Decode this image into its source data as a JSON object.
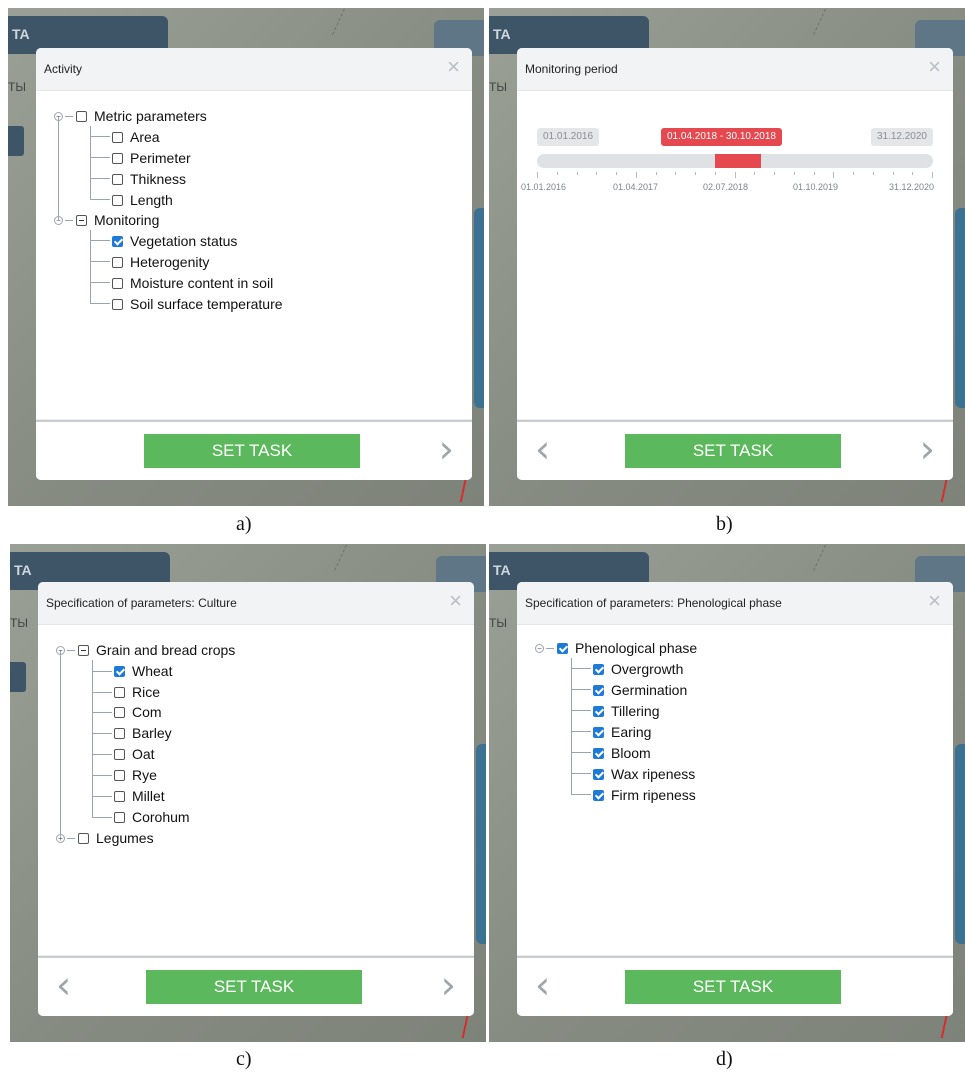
{
  "panels": {
    "a": {
      "caption": "a)",
      "map_tab": "TA",
      "map_side": "ТЫ",
      "title": "Activity",
      "close": "×",
      "set_task": "SET TASK",
      "next": "›",
      "tree": [
        {
          "label": "Metric parameters",
          "state": "unchecked",
          "expand": "−"
        },
        {
          "label": "Area",
          "state": "unchecked"
        },
        {
          "label": "Perimeter",
          "state": "unchecked"
        },
        {
          "label": "Thikness",
          "state": "unchecked"
        },
        {
          "label": "Length",
          "state": "unchecked"
        },
        {
          "label": "Monitoring",
          "state": "partial",
          "expand": "−"
        },
        {
          "label": "Vegetation status",
          "state": "checked"
        },
        {
          "label": "Heterogenity",
          "state": "unchecked"
        },
        {
          "label": "Moisture content in soil",
          "state": "unchecked"
        },
        {
          "label": "Soil surface temperature",
          "state": "unchecked"
        }
      ]
    },
    "b": {
      "caption": "b)",
      "map_tab": "TA",
      "map_side": "ТЫ",
      "title": "Monitoring period",
      "close": "×",
      "set_task": "SET TASK",
      "prev": "‹",
      "next": "›",
      "timeline": {
        "min_label": "01.01.2016",
        "max_label": "31.12.2020",
        "range_label": "01.04.2018 - 30.10.2018",
        "range_start_fraction": 0.45,
        "range_end_fraction": 0.565,
        "axis_labels": [
          "01.01.2016",
          "01.04.2017",
          "02.07.2018",
          "01.10.2019",
          "31.12.2020"
        ]
      }
    },
    "c": {
      "caption": "c)",
      "map_tab": "TA",
      "map_side": "ТЫ",
      "title": "Specification of parameters: Culture",
      "close": "×",
      "set_task": "SET TASK",
      "prev": "‹",
      "next": "›",
      "tree": [
        {
          "label": "Grain and bread crops",
          "state": "partial",
          "expand": "−"
        },
        {
          "label": "Wheat",
          "state": "checked"
        },
        {
          "label": "Rice",
          "state": "unchecked"
        },
        {
          "label": "Com",
          "state": "unchecked"
        },
        {
          "label": "Barley",
          "state": "unchecked"
        },
        {
          "label": "Oat",
          "state": "unchecked"
        },
        {
          "label": "Rye",
          "state": "unchecked"
        },
        {
          "label": "Millet",
          "state": "unchecked"
        },
        {
          "label": "Corohum",
          "state": "unchecked"
        },
        {
          "label": "Legumes",
          "state": "unchecked",
          "expand": "+"
        }
      ]
    },
    "d": {
      "caption": "d)",
      "map_tab": "TA",
      "map_side": "ТЫ",
      "title": "Specification of parameters: Phenological phase",
      "close": "×",
      "set_task": "SET TASK",
      "prev": "‹",
      "tree": [
        {
          "label": "Phenological phase",
          "state": "checked",
          "expand": "−"
        },
        {
          "label": "Overgrowth",
          "state": "checked"
        },
        {
          "label": "Germination",
          "state": "checked"
        },
        {
          "label": "Tillering",
          "state": "checked"
        },
        {
          "label": "Earing",
          "state": "checked"
        },
        {
          "label": "Bloom",
          "state": "checked"
        },
        {
          "label": "Wax ripeness",
          "state": "checked"
        },
        {
          "label": "Firm ripeness",
          "state": "checked"
        }
      ]
    }
  },
  "colors": {
    "set_task": "#5cb85c",
    "checked": "#1e7ad9",
    "range": "#e6484f",
    "map_tab": "#3d5566"
  }
}
